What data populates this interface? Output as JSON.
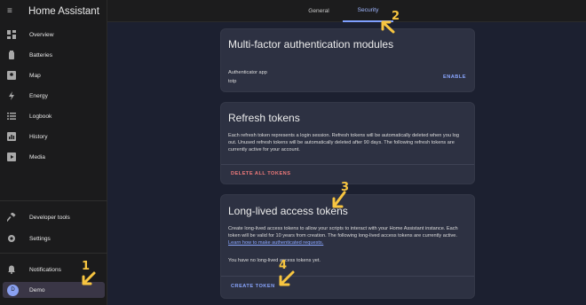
{
  "sidebar": {
    "title": "Home Assistant",
    "items": [
      {
        "label": "Overview",
        "icon": "grid-icon"
      },
      {
        "label": "Batteries",
        "icon": "battery-icon"
      },
      {
        "label": "Map",
        "icon": "map-icon"
      },
      {
        "label": "Energy",
        "icon": "lightning-icon"
      },
      {
        "label": "Logbook",
        "icon": "list-icon"
      },
      {
        "label": "History",
        "icon": "chart-icon"
      },
      {
        "label": "Media",
        "icon": "media-icon"
      }
    ],
    "bottom": [
      {
        "label": "Developer tools",
        "icon": "hammer-icon"
      },
      {
        "label": "Settings",
        "icon": "gear-icon"
      },
      {
        "label": "Notifications",
        "icon": "bell-icon"
      }
    ],
    "user": {
      "initial": "D",
      "label": "Demo"
    }
  },
  "tabs": [
    {
      "label": "General"
    },
    {
      "label": "Security"
    }
  ],
  "mfa": {
    "title": "Multi-factor authentication modules",
    "module_name": "Authenticator app",
    "module_id": "totp",
    "action": "ENABLE"
  },
  "refresh": {
    "title": "Refresh tokens",
    "text": "Each refresh token represents a login session. Refresh tokens will be automatically deleted when you log out. Unused refresh tokens will be automatically deleted after 90 days. The following refresh tokens are currently active for your account.",
    "action": "DELETE ALL TOKENS"
  },
  "longlived": {
    "title": "Long-lived access tokens",
    "text": "Create long-lived access tokens to allow your scripts to interact with your Home Assistant instance. Each token will be valid for 10 years from creation. The following long-lived access tokens are currently active.",
    "link": "Learn how to make authenticated requests.",
    "empty": "You have no long-lived access tokens yet.",
    "action": "CREATE TOKEN"
  },
  "annotations": [
    "1",
    "2",
    "3",
    "4"
  ],
  "colors": {
    "accent": "#8aa6ff",
    "danger": "#f07a7a",
    "marker": "#f7c540"
  }
}
